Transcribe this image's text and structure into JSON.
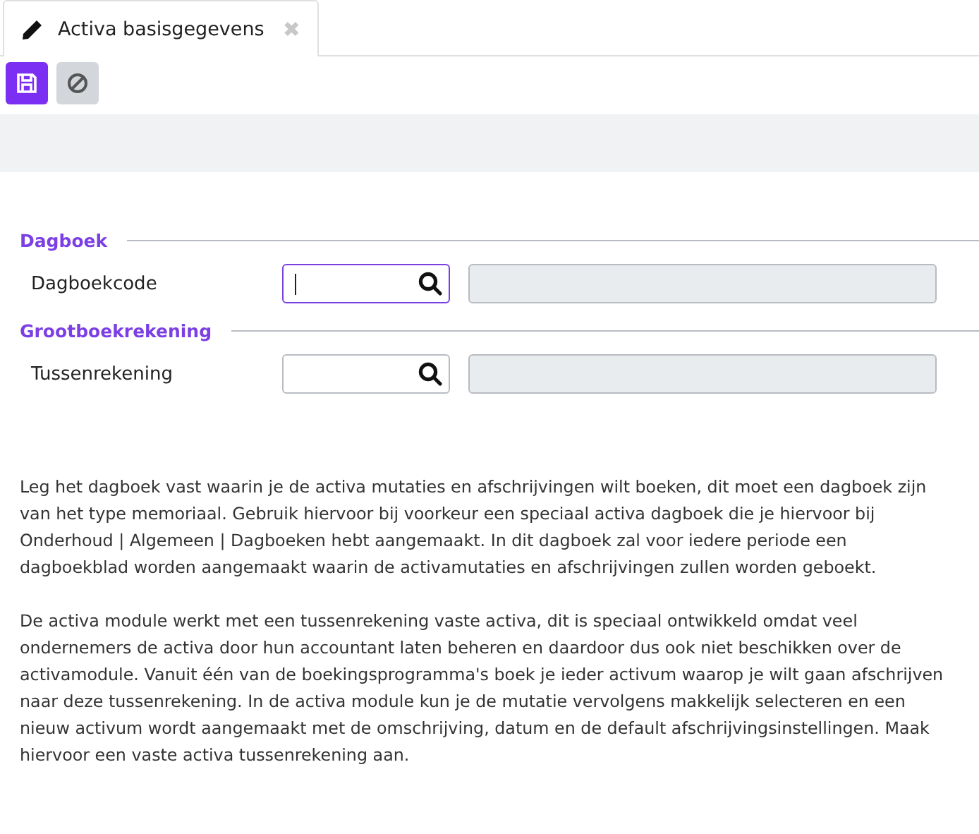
{
  "tab": {
    "title": "Activa basisgegevens",
    "selected": true,
    "close": "✖"
  },
  "toolbar": [
    {
      "kind": "save",
      "disabled": false
    },
    {
      "kind": "cancel",
      "disabled": true
    }
  ],
  "sections": [
    {
      "title": "Dagboek",
      "fields": [
        {
          "label": "Dagboekcode",
          "focused": true
        }
      ]
    },
    {
      "title": "Grootboekrekening",
      "fields": [
        {
          "label": "Tussenrekening",
          "focused": false
        }
      ]
    }
  ],
  "paragraphs": [
    "Leg het dagboek vast waarin je de activa mutaties en afschrijvingen wilt boeken, dit moet een dagboek zijn van het type memoriaal. Gebruik hiervoor bij voorkeur een speciaal activa dagboek die je hiervoor bij Onderhoud | Algemeen | Dagboeken hebt aangemaakt. In dit dagboek zal voor iedere periode een dagboekblad worden aangemaakt waarin de activamutaties en afschrijvingen zullen worden geboekt.",
    "De activa module werkt met een tussenrekening vaste activa, dit is speciaal ontwikkeld omdat veel ondernemers de activa door hun accountant laten beheren en daardoor dus ook niet beschikken over de activamodule. Vanuit één van de boekingsprogramma's boek je ieder activum waarop je wilt gaan afschrijven naar deze tussenrekening. In de activa module kun je de mutatie vervolgens makkelijk selecteren en een nieuw activum wordt aangemaakt met de omschrijving, datum en de default afschrijvingsinstellingen. Maak hiervoor een vaste activa tussenrekening aan."
  ]
}
